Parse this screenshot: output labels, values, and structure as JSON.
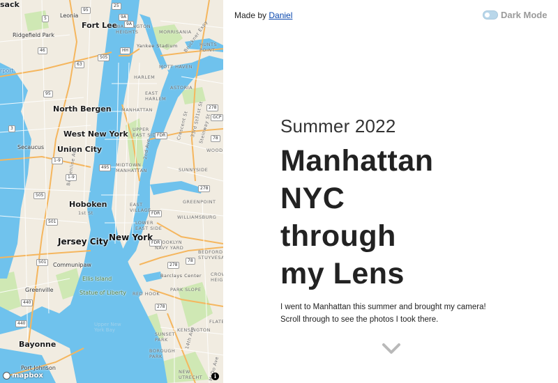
{
  "header": {
    "made_by_prefix": "Made by",
    "author_link": "Daniel",
    "dark_mode_label": "Dark Mode",
    "dark_mode_on": false
  },
  "hero": {
    "subtitle": "Summer 2022",
    "title": "Manhattan NYC through my Lens",
    "description": "I went to Manhattan this summer and brought my camera! Scroll through to see the photos I took there."
  },
  "map": {
    "attribution_logo": "mapbox",
    "info_label": "i",
    "colors": {
      "water": "#6fc2ed",
      "land": "#f1ece1",
      "park": "#cfe8b4",
      "road_major": "#f5b65e",
      "road_minor": "#ffffff"
    },
    "labels": {
      "hackensack": "sack",
      "leonia": "Leonia",
      "fort_lee": "Fort Lee",
      "ridgefield_park": "Ridgefield Park",
      "airport": "rport",
      "north_bergen": "North Bergen",
      "west_new_york": "West New York",
      "secaucus": "Secaucus",
      "union_city": "Union City",
      "hoboken": "Hoboken",
      "jersey_city": "Jersey City",
      "new_york": "New York",
      "communipaw": "Communipaw",
      "greenville": "Greenville",
      "bayonne": "Bayonne",
      "port_johnson": "Port Johnson",
      "ellis_island": "Ellis Island",
      "statue_of_liberty": "Statue of Liberty",
      "upper_new_york_bay": "Upper New\nYork Bay",
      "washington_heights": "WASHINGTON\nHEIGHTS",
      "morrisania": "MORRISANIA",
      "hunts_point": "HUNTS\nPOINT",
      "yankee_stadium": "Yankee Stadium",
      "mott_haven": "MOTT HAVEN",
      "harlem": "HARLEM",
      "east_harlem": "EAST\nHARLEM",
      "astoria": "ASTORIA",
      "manhattan": "MANHATTAN",
      "upper_east_side": "UPPER\nEAST SIDE",
      "woods": "WOODS",
      "midtown": "MIDTOWN\nMANHATTAN",
      "sunnyside": "SUNNYSIDE",
      "greenpoint": "GREENPOINT",
      "east_village": "EAST\nVILLAGE",
      "lower_east_side": "LOWER\nEAST SIDE",
      "williamsburg": "WILLIAMSBURG",
      "brooklyn_navy_yard": "BROOKLYN\nNAVY YARD",
      "bedford": "BEDFORD-\nSTUYVESAN",
      "barclays": "Barclays Center",
      "red_hook": "RED HOOK",
      "park_slope": "PARK SLOPE",
      "crown": "CROW\nHEIGH",
      "sunset_park": "SUNSET\nPARK",
      "borough_park": "BOROUGH\nPARK",
      "kensington": "KENSINGTON",
      "new_utrecht": "NEW\nUTRECHT",
      "flatbush": "FLATB",
      "crescent": "Crescent St",
      "st_31": "31st St",
      "st_33": "33rd St",
      "steinway": "Steinway St",
      "bruckner": "Bruckner Expy",
      "ave_2": "2nd Ave",
      "st_1": "1st St",
      "ave_14": "14th Ave",
      "mcdonald": "McDo Ave",
      "bergenline": "Bergenline Ave"
    },
    "shields": [
      "95",
      "5",
      "9A",
      "46",
      "63",
      "HH",
      "505",
      "95",
      "3",
      "1-9",
      "495",
      "501",
      "440",
      "505",
      "440",
      "501",
      "FDR",
      "FDR",
      "FDR",
      "278",
      "GCP",
      "278",
      "78",
      "278",
      "78",
      "278",
      "9A",
      "1-9",
      "25"
    ]
  }
}
